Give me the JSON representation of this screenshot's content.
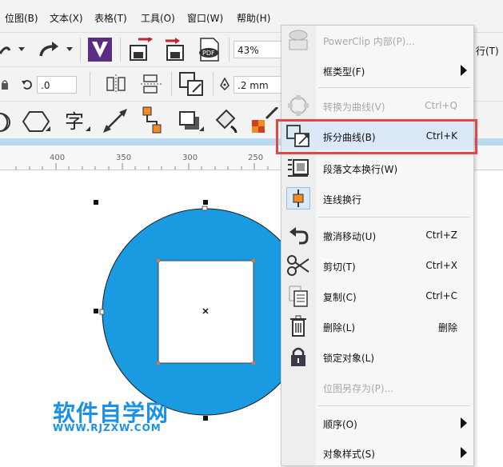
{
  "menubar": {
    "items": [
      "位图(B)",
      "文本(X)",
      "表格(T)",
      "工具(O)",
      "窗口(W)",
      "帮助(H)"
    ]
  },
  "toolbar1": {
    "zoom": "43%",
    "right_partial": "行(T)"
  },
  "toolbar2": {
    "rotation_value": ".0",
    "outline_width": ".2 mm"
  },
  "ruler": {
    "ticks": [
      "400",
      "350",
      "300",
      "250"
    ]
  },
  "context_menu": {
    "items": [
      {
        "label": "PowerClip 内部(P)...",
        "shortcut": "",
        "disabled": true,
        "submenu": false,
        "icon": "powerclip-icon"
      },
      {
        "label": "框类型(F)",
        "shortcut": "",
        "disabled": false,
        "submenu": true,
        "icon": ""
      },
      {
        "label": "转换为曲线(V)",
        "shortcut": "Ctrl+Q",
        "disabled": true,
        "submenu": false,
        "icon": "convert-to-curves-icon"
      },
      {
        "label": "拆分曲线(B)",
        "shortcut": "Ctrl+K",
        "disabled": false,
        "submenu": false,
        "icon": "break-apart-icon",
        "highlighted": true
      },
      {
        "label": "段落文本换行(W)",
        "shortcut": "",
        "disabled": false,
        "submenu": false,
        "icon": "paragraph-wrap-icon"
      },
      {
        "label": "连线换行",
        "shortcut": "",
        "disabled": false,
        "submenu": false,
        "icon": "connector-wrap-icon"
      },
      {
        "label": "撤消移动(U)",
        "shortcut": "Ctrl+Z",
        "disabled": false,
        "submenu": false,
        "icon": "undo-icon"
      },
      {
        "label": "剪切(T)",
        "shortcut": "Ctrl+X",
        "disabled": false,
        "submenu": false,
        "icon": "scissors-icon"
      },
      {
        "label": "复制(C)",
        "shortcut": "Ctrl+C",
        "disabled": false,
        "submenu": false,
        "icon": "copy-icon"
      },
      {
        "label": "删除(L)",
        "shortcut": "删除",
        "disabled": false,
        "submenu": false,
        "icon": "trash-icon"
      },
      {
        "label": "锁定对象(L)",
        "shortcut": "",
        "disabled": false,
        "submenu": false,
        "icon": "lock-icon"
      },
      {
        "label": "位图另存为(P)...",
        "shortcut": "",
        "disabled": true,
        "submenu": false,
        "icon": ""
      },
      {
        "label": "顺序(O)",
        "shortcut": "",
        "disabled": false,
        "submenu": true,
        "icon": ""
      },
      {
        "label": "对象样式(S)",
        "shortcut": "",
        "disabled": false,
        "submenu": true,
        "icon": ""
      }
    ]
  },
  "canvas": {
    "circle_color": "#1a9ae0",
    "highlight_color": "#e04848"
  },
  "watermark": {
    "title": "软件自学网",
    "url": "WWW.RJZXW.COM"
  }
}
